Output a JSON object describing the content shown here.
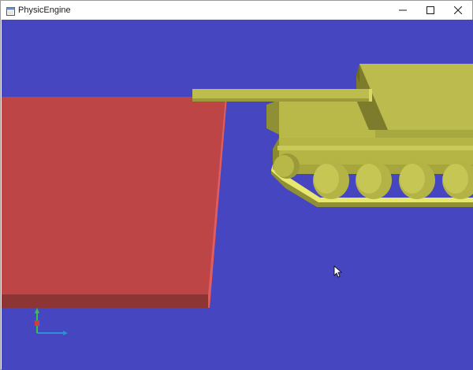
{
  "window": {
    "title": "PhysicEngine",
    "controls": {
      "minimize": "minimize",
      "maximize": "maximize",
      "close": "close"
    }
  },
  "viewport": {
    "background_color": "#4646c0",
    "objects": [
      {
        "name": "ground-plane",
        "color": "#bd4545"
      },
      {
        "name": "tank",
        "color": "#bdbd4f"
      }
    ],
    "axes_gizmo": {
      "x_color": "#2f8fd6",
      "y_color": "#36c24a",
      "z_color": "#d04040"
    }
  },
  "icons": {
    "app": "app-icon",
    "minimize": "minimize-icon",
    "maximize": "maximize-icon",
    "close": "close-icon",
    "cursor": "mouse-cursor-icon"
  }
}
